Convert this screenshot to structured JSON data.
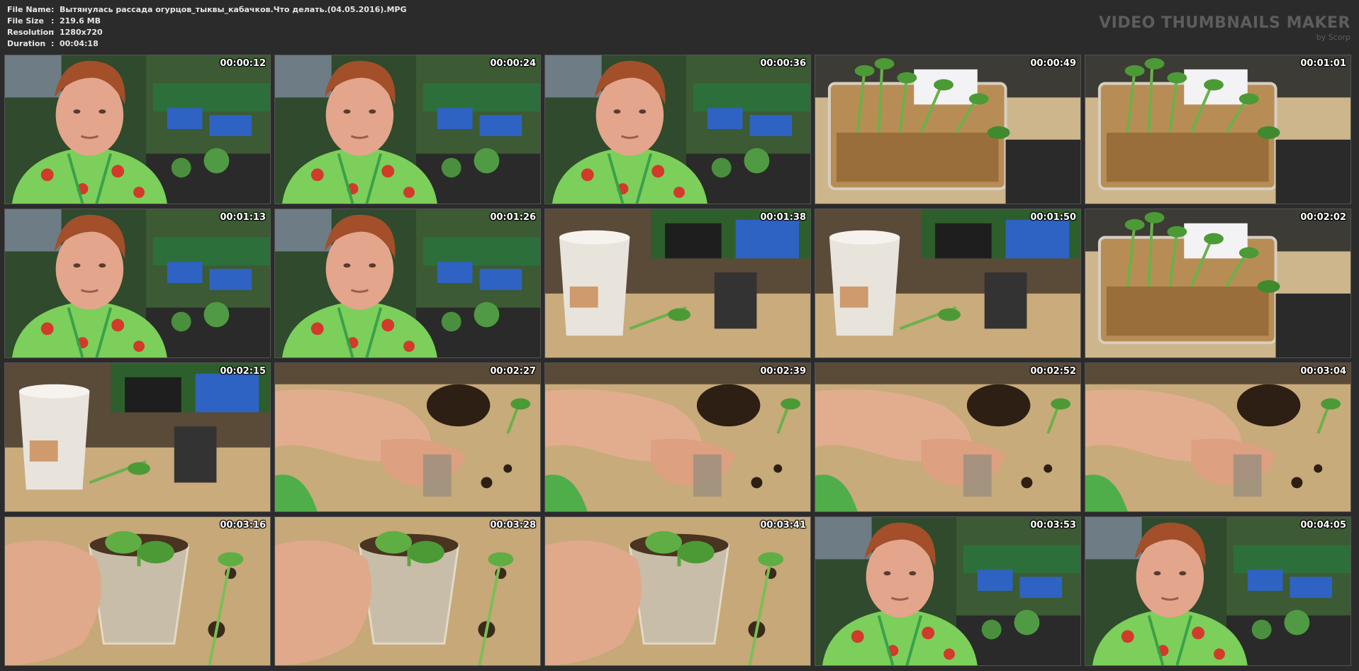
{
  "header": {
    "file_name_label": "File Name",
    "file_name_value": "Вытянулась рассада огурцов_тыквы_кабачков.Что делать.(04.05.2016).MPG",
    "file_size_label": "File Size",
    "file_size_value": "219.6 MB",
    "resolution_label": "Resolution",
    "resolution_value": "1280x720",
    "duration_label": "Duration",
    "duration_value": "00:04:18",
    "separator": ":"
  },
  "brand": {
    "title": "VIDEO THUMBNAILS MAKER",
    "subtitle": "by Scorp"
  },
  "thumbnails": [
    {
      "time": "00:00:12",
      "scene": "woman"
    },
    {
      "time": "00:00:24",
      "scene": "woman"
    },
    {
      "time": "00:00:36",
      "scene": "woman"
    },
    {
      "time": "00:00:49",
      "scene": "seedlings"
    },
    {
      "time": "00:01:01",
      "scene": "seedlings"
    },
    {
      "time": "00:01:13",
      "scene": "woman"
    },
    {
      "time": "00:01:26",
      "scene": "woman"
    },
    {
      "time": "00:01:38",
      "scene": "bucket"
    },
    {
      "time": "00:01:50",
      "scene": "bucket"
    },
    {
      "time": "00:02:02",
      "scene": "seedlings"
    },
    {
      "time": "00:02:15",
      "scene": "bucket"
    },
    {
      "time": "00:02:27",
      "scene": "hands"
    },
    {
      "time": "00:02:39",
      "scene": "hands"
    },
    {
      "time": "00:02:52",
      "scene": "hands"
    },
    {
      "time": "00:03:04",
      "scene": "hands"
    },
    {
      "time": "00:03:16",
      "scene": "cup"
    },
    {
      "time": "00:03:28",
      "scene": "cup"
    },
    {
      "time": "00:03:41",
      "scene": "cup"
    },
    {
      "time": "00:03:53",
      "scene": "woman"
    },
    {
      "time": "00:04:05",
      "scene": "woman"
    }
  ]
}
